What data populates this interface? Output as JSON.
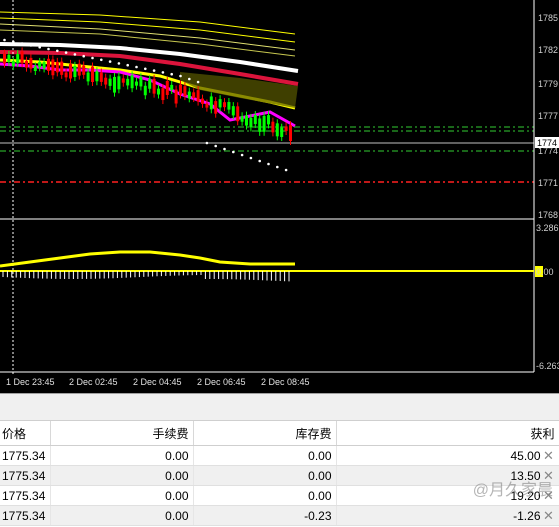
{
  "chart": {
    "price_axis_labels": [
      "1785",
      "1782",
      "1779",
      "1777",
      "1774",
      "1774",
      "1771",
      "1768"
    ],
    "current_price_tag": "1774",
    "indicator_axis_labels": {
      "top": "3.286",
      "zero": "0.00",
      "bottom": "-6.263"
    },
    "time_labels": [
      "1 Dec 23:45",
      "2 Dec 02:45",
      "2 Dec 04:45",
      "2 Dec 06:45",
      "2 Dec 08:45"
    ],
    "colors": {
      "background": "#000000",
      "ma_fast": "#ff00ff",
      "ma_slow": "#dc143c",
      "ma_trend": "#ffffff",
      "band": "#ffff00",
      "bull_candle": "#00ff00",
      "bear_candle": "#ff0000",
      "green_level": "#32cd32",
      "red_level": "#ff2020",
      "zero_line": "#ffff00"
    }
  },
  "terminal": {
    "columns": [
      "价格",
      "手续费",
      "库存费",
      "获利"
    ],
    "rows": [
      [
        "1775.34",
        "0.00",
        "0.00",
        "45.00"
      ],
      [
        "1775.34",
        "0.00",
        "0.00",
        "13.50"
      ],
      [
        "1775.34",
        "0.00",
        "0.00",
        "19.20"
      ],
      [
        "1775.34",
        "0.00",
        "-0.23",
        "-1.26"
      ]
    ],
    "close_icon": "close-icon",
    "watermark": "@月久家晨"
  }
}
